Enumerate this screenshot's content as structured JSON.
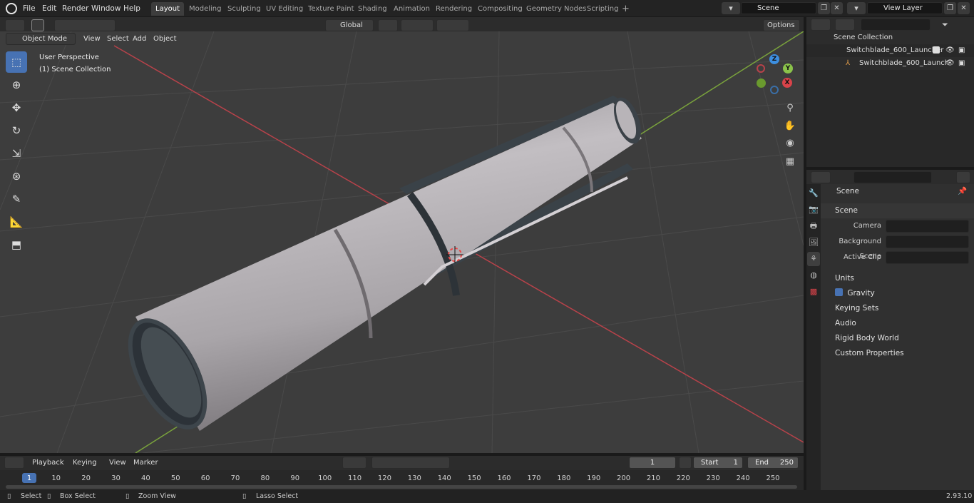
{
  "menu": {
    "file": "File",
    "edit": "Edit",
    "render": "Render",
    "window": "Window",
    "help": "Help"
  },
  "workspaces": [
    "Layout",
    "Modeling",
    "Sculpting",
    "UV Editing",
    "Texture Paint",
    "Shading",
    "Animation",
    "Rendering",
    "Compositing",
    "Geometry Nodes",
    "Scripting"
  ],
  "topbar": {
    "scene": "Scene",
    "view_layer": "View Layer"
  },
  "viewport_header": {
    "mode": "Object Mode",
    "view": "View",
    "select": "Select",
    "add": "Add",
    "object": "Object",
    "orientation": "Global",
    "options": "Options"
  },
  "viewport": {
    "perspective_label": "User Perspective",
    "collection_label": "(1) Scene Collection",
    "gizmo": {
      "z": "Z",
      "y": "Y",
      "x": "X"
    }
  },
  "outliner": {
    "root": "Scene Collection",
    "collection": "Switchblade_600_Launcher",
    "object": "Switchblade_600_Launch"
  },
  "properties": {
    "context": "Scene",
    "panel_title": "Scene",
    "camera_label": "Camera",
    "background_scene_label": "Background Scene",
    "active_clip_label": "Active Clip",
    "sections": [
      "Units",
      "Gravity",
      "Keying Sets",
      "Audio",
      "Rigid Body World",
      "Custom Properties"
    ],
    "gravity_enabled": true
  },
  "timeline": {
    "playback": "Playback",
    "keying": "Keying",
    "view": "View",
    "marker": "Marker",
    "current_frame": "1",
    "start_label": "Start",
    "start": "1",
    "end_label": "End",
    "end": "250",
    "ticks": [
      "1",
      "10",
      "20",
      "30",
      "40",
      "50",
      "60",
      "70",
      "80",
      "90",
      "100",
      "110",
      "120",
      "130",
      "140",
      "150",
      "160",
      "170",
      "180",
      "190",
      "200",
      "210",
      "220",
      "230",
      "240",
      "250"
    ]
  },
  "statusbar": {
    "select": "Select",
    "box_select": "Box Select",
    "zoom_view": "Zoom View",
    "lasso_select": "Lasso Select",
    "version": "2.93.10"
  },
  "colors": {
    "accent": "#4772b3",
    "x_axis": "#d9434a",
    "y_axis": "#8bc34a",
    "z_axis": "#3d8fe0"
  }
}
